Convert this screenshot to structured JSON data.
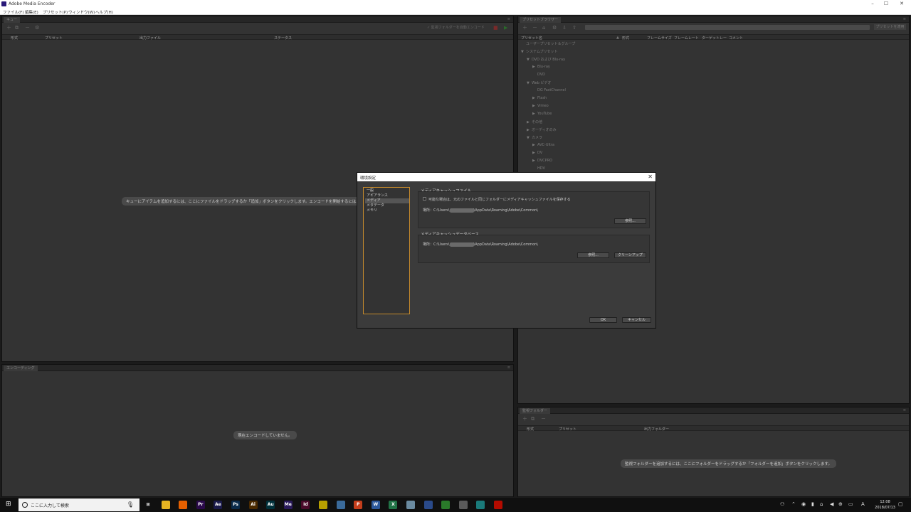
{
  "window": {
    "title": "Adobe Media Encoder",
    "controls": {
      "minimize": "–",
      "maximize": "☐",
      "close": "✕"
    }
  },
  "menu": [
    "ファイル(F)",
    "編集(E)",
    "プリセット(P)",
    "ウィンドウ(W)",
    "ヘルプ(H)"
  ],
  "queue": {
    "tab": "キュー",
    "auto_encode_label": "✓ 監視フォルダーを自動エンコード",
    "columns": [
      "形式",
      "プリセット",
      "出力ファイル",
      "ステータス"
    ],
    "empty_message": "キューにアイテムを追加するには、ここにファイルをドラッグするか「追加」ボタンをクリックします。エンコードを開始するには、「キューを開始」ボ"
  },
  "encoding": {
    "tab": "エンコーディング",
    "empty_message": "現在エンコードしていません。"
  },
  "preset_browser": {
    "tab": "プリセットブラウザー",
    "apply_button": "プリセットを適用",
    "columns": [
      "プリセット名",
      "形式",
      "フレームサイズ",
      "フレームレート",
      "ターゲットレー",
      "コメント"
    ],
    "rows": [
      {
        "label": "ユーザープリセット＆グループ",
        "indent": 0,
        "arrow": ""
      },
      {
        "label": "システムプリセット",
        "indent": 0,
        "arrow": "▼"
      },
      {
        "label": "DVD および Blu-ray",
        "indent": 1,
        "arrow": "▼"
      },
      {
        "label": "Blu-ray",
        "indent": 2,
        "arrow": "▶"
      },
      {
        "label": "DVD",
        "indent": 2,
        "arrow": ""
      },
      {
        "label": "Web ビデオ",
        "indent": 1,
        "arrow": "▼"
      },
      {
        "label": "DG FastChannel",
        "indent": 2,
        "arrow": ""
      },
      {
        "label": "Flash",
        "indent": 2,
        "arrow": "▶"
      },
      {
        "label": "Vimeo",
        "indent": 2,
        "arrow": "▶"
      },
      {
        "label": "YouTube",
        "indent": 2,
        "arrow": "▶"
      },
      {
        "label": "その他",
        "indent": 1,
        "arrow": "▶"
      },
      {
        "label": "オーディオのみ",
        "indent": 1,
        "arrow": "▶"
      },
      {
        "label": "カメラ",
        "indent": 1,
        "arrow": "▼"
      },
      {
        "label": "AVC-Ultra",
        "indent": 2,
        "arrow": "▶"
      },
      {
        "label": "DV",
        "indent": 2,
        "arrow": "▶"
      },
      {
        "label": "DVCPRO",
        "indent": 2,
        "arrow": "▶"
      },
      {
        "label": "HDV",
        "indent": 2,
        "arrow": ""
      }
    ]
  },
  "watch_folders": {
    "tab": "監視フォルダー",
    "columns": [
      "形式",
      "プリセット",
      "出力フォルダー"
    ],
    "empty_message": "監視フォルダーを追加するには、ここにフォルダーをドラッグするか「フォルダーを追加」ボタンをクリックします。"
  },
  "dialog": {
    "title": "環境設定",
    "categories": [
      "一般",
      "アピアランス",
      "メディア",
      "メタデータ",
      "メモリ"
    ],
    "selected_category": "メディア",
    "media_cache_files": {
      "label": "メディアキャッシュファイル",
      "checkbox_label": "可能な場合は、元のファイルと同じフォルダーにメディアキャッシュファイルを保存する",
      "location_prefix": "場所：C:\\Users\\",
      "location_suffix": "\\AppData\\Roaming\\Adobe\\Common\\",
      "browse_button": "参照..."
    },
    "media_cache_db": {
      "label": "メディアキャッシュデータベース",
      "location_prefix": "場所：C:\\Users\\",
      "location_suffix": "\\AppData\\Roaming\\Adobe\\Common\\",
      "browse_button": "参照...",
      "cleanup_button": "クリーンアップ"
    },
    "ok_button": "OK",
    "cancel_button": "キャンセル"
  },
  "taskbar": {
    "search_placeholder": "ここに入力して検索",
    "apps": [
      {
        "name": "task-view",
        "label": "⊞",
        "color": "#101010"
      },
      {
        "name": "explorer",
        "label": "",
        "color": "#e6b422"
      },
      {
        "name": "firefox",
        "label": "",
        "color": "#e66000"
      },
      {
        "name": "premiere",
        "label": "Pr",
        "color": "#2a0a4a"
      },
      {
        "name": "after-effects",
        "label": "Ae",
        "color": "#1a1a4a"
      },
      {
        "name": "photoshop",
        "label": "Ps",
        "color": "#0a2a4a"
      },
      {
        "name": "illustrator",
        "label": "Ai",
        "color": "#4a2a00"
      },
      {
        "name": "audition",
        "label": "Au",
        "color": "#00303a"
      },
      {
        "name": "media-encoder",
        "label": "Me",
        "color": "#2a1a5a"
      },
      {
        "name": "indesign",
        "label": "Id",
        "color": "#4a0a2a"
      },
      {
        "name": "app-11",
        "label": "",
        "color": "#b8a000"
      },
      {
        "name": "app-12",
        "label": "",
        "color": "#3a6a9a"
      },
      {
        "name": "powerpoint",
        "label": "P",
        "color": "#c43e1c"
      },
      {
        "name": "word",
        "label": "W",
        "color": "#2b579a"
      },
      {
        "name": "excel",
        "label": "X",
        "color": "#217346"
      },
      {
        "name": "app-16",
        "label": "",
        "color": "#6a8aa0"
      },
      {
        "name": "app-17",
        "label": "",
        "color": "#2a4a8a"
      },
      {
        "name": "app-18",
        "label": "",
        "color": "#2a7a2a"
      },
      {
        "name": "app-19",
        "label": "",
        "color": "#5a5a5a"
      },
      {
        "name": "app-20",
        "label": "",
        "color": "#1a7a7a"
      },
      {
        "name": "acrobat",
        "label": "",
        "color": "#b30b00"
      }
    ],
    "tray_input": "A",
    "time": "12:08",
    "date": "2018/07/13"
  },
  "colors": {
    "accent": "#c58a2c",
    "panel": "#333333",
    "background": "#1b1b1b"
  }
}
